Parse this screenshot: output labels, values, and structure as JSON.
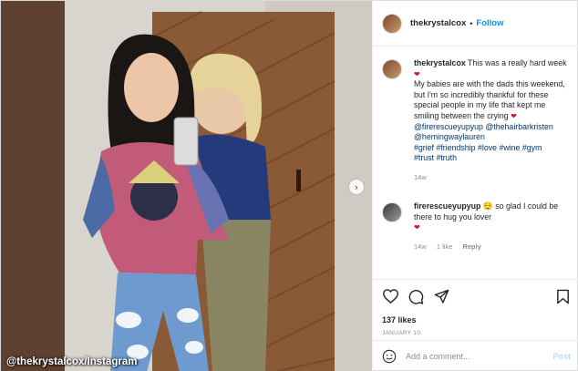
{
  "photo": {
    "credit": "@thekrystalcox/Instagram",
    "next_icon": "chevron-right-icon"
  },
  "header": {
    "username": "thekrystalcox",
    "separator": "•",
    "follow_label": "Follow"
  },
  "caption": {
    "username": "thekrystalcox",
    "line1": "This was a really hard week",
    "line2": "My babies are with the dads this weekend, but I'm so incredibly thankful for these special people in my life that kept me smiling between the crying",
    "mentions": [
      "@firerescueyupyup",
      "@thehairbarkristen",
      "@hemingwaylauren"
    ],
    "hashtags": [
      "#grief",
      "#friendship",
      "#love",
      "#wine",
      "#gym",
      "#trust",
      "#truth"
    ],
    "heart": "❤",
    "time": "14w"
  },
  "comment": {
    "username": "firerescueyupyup",
    "emoji": "😌",
    "text": "so glad I could be there to hug you lover",
    "heart": "❤",
    "time": "14w",
    "likes": "1 like",
    "reply_label": "Reply"
  },
  "actions": {
    "icons": [
      "heart-icon",
      "comment-icon",
      "share-icon",
      "bookmark-icon"
    ],
    "likes": "137 likes",
    "date": "JANUARY 10"
  },
  "add_comment": {
    "placeholder": "Add a comment...",
    "post_label": "Post",
    "icon": "smile-icon"
  },
  "colors": {
    "link": "#0095f6",
    "text": "#262626",
    "muted": "#8e8e8e",
    "heart": "#d11a2a",
    "door": "#8a5a36"
  }
}
